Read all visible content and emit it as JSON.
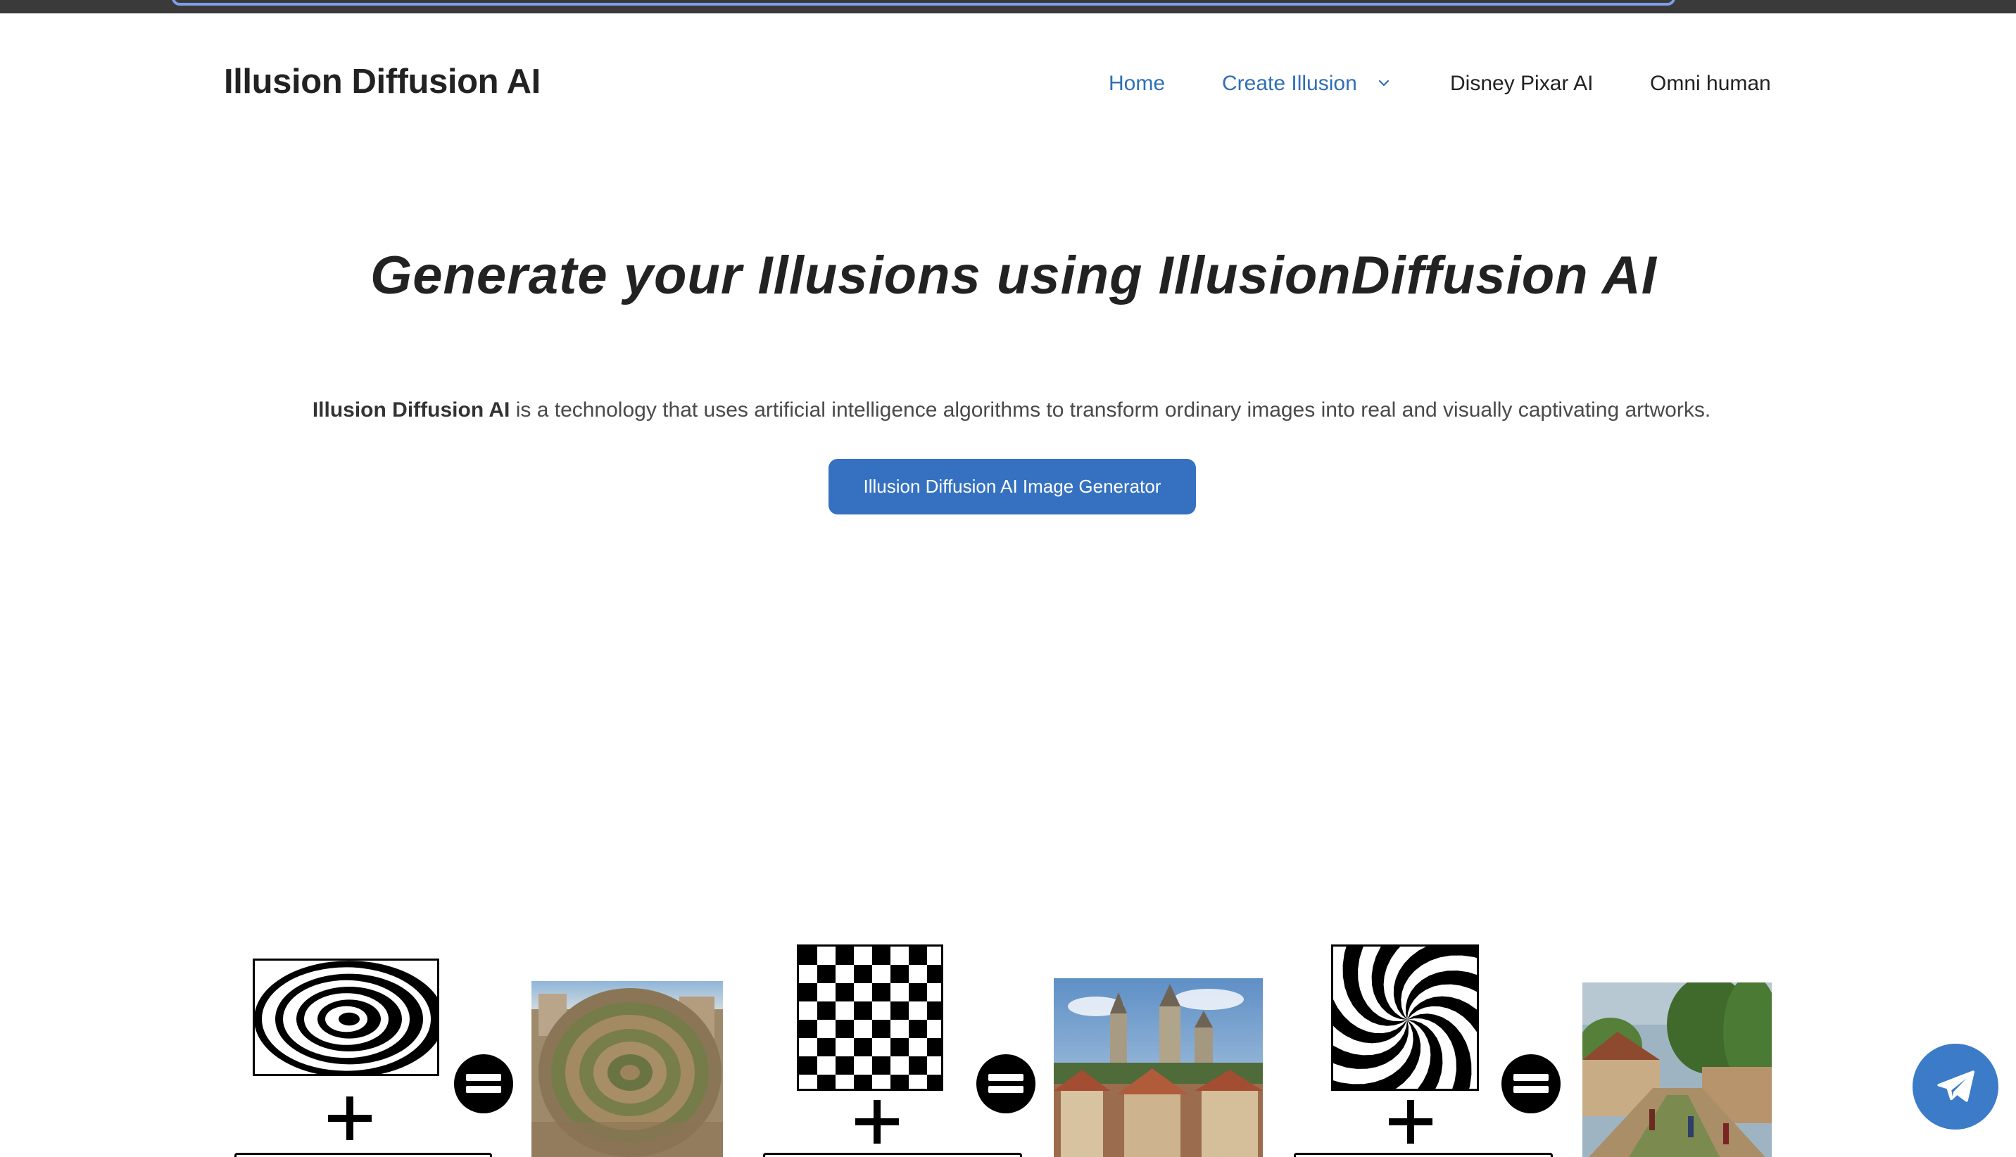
{
  "header": {
    "site_title": "Illusion Diffusion AI",
    "nav": {
      "home": "Home",
      "create_illusion": "Create Illusion",
      "disney_pixar": "Disney Pixar AI",
      "omni_human": "Omni human"
    }
  },
  "hero": {
    "title": "Generate your Illusions using IllusionDiffusion AI",
    "intro_bold": "Illusion Diffusion AI",
    "intro_rest": " is a technology that uses artificial intelligence algorithms to transform ordinary images into real and visually captivating artworks.",
    "cta_label": "Illusion Diffusion AI Image Generator"
  },
  "demos": [
    {
      "pattern": "spiral-pattern",
      "result": "spiral-village-artwork"
    },
    {
      "pattern": "checkerboard-pattern",
      "result": "castle-town-artwork"
    },
    {
      "pattern": "swirl-pattern",
      "result": "village-street-artwork"
    }
  ],
  "icons": {
    "nav_dropdown": "chevron-down-icon",
    "plus": "plus-icon",
    "equals": "equals-icon",
    "chat": "telegram-icon"
  },
  "colors": {
    "accent": "#3571c0",
    "nav_link": "#2f6fb6",
    "topbar": "#3a3a3a",
    "text": "#222222"
  }
}
